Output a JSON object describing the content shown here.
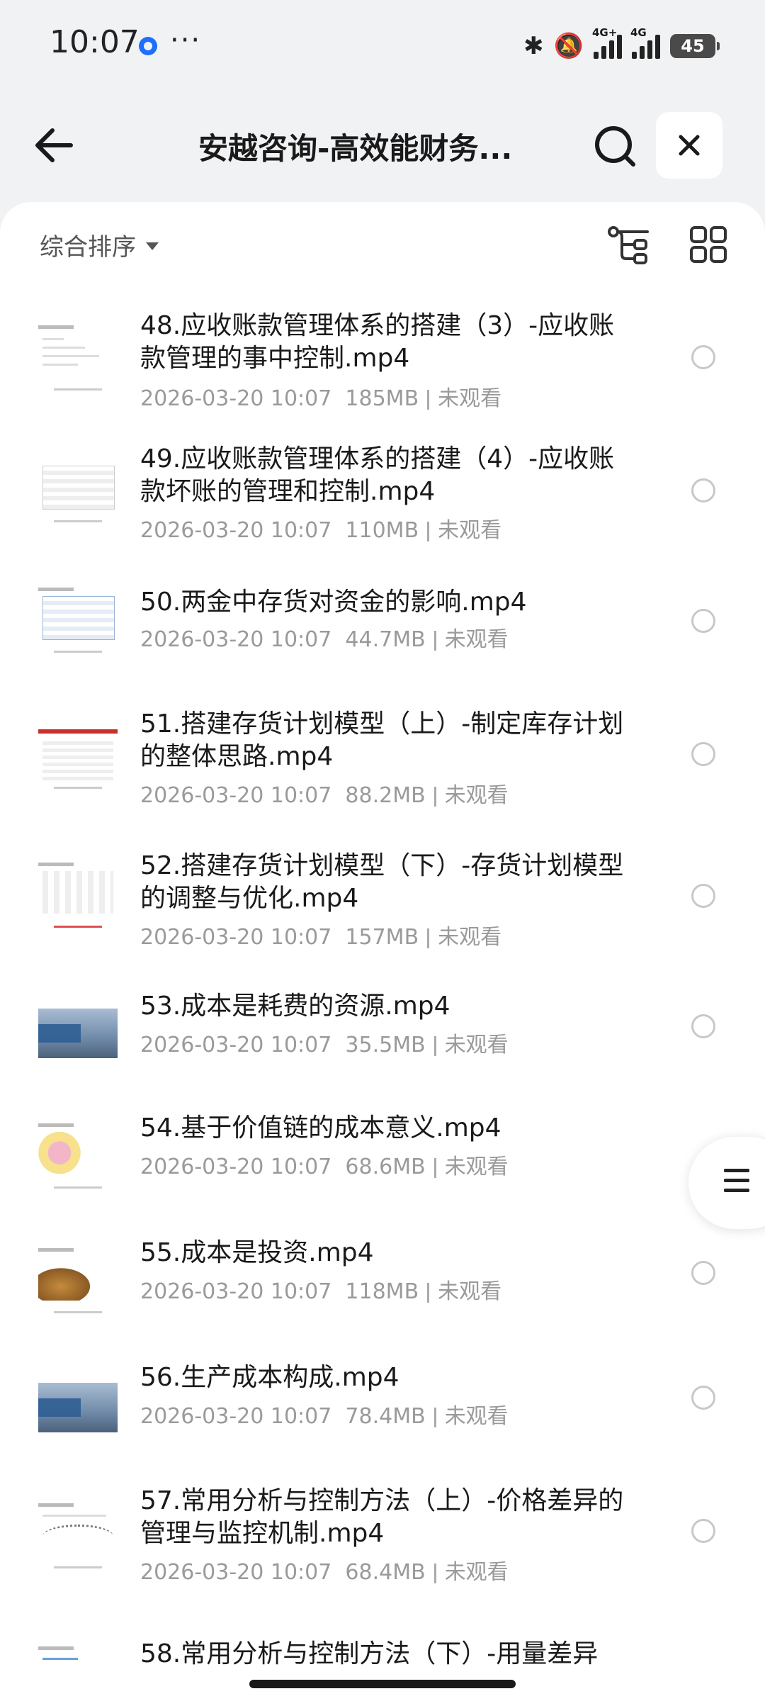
{
  "status": {
    "time": "10:07",
    "more": "···",
    "net1": "4G+",
    "net2": "4G",
    "battery": "45"
  },
  "header": {
    "title": "安越咨询-高效能财务..."
  },
  "toolbar": {
    "sort_label": "综合排序"
  },
  "items": [
    {
      "name": "48.应收账款管理体系的搭建（3）-应收账款管理的事中控制.mp4",
      "date": "2026-03-20 10:07",
      "size": "185MB",
      "status": "未观看"
    },
    {
      "name": "49.应收账款管理体系的搭建（4）-应收账款坏账的管理和控制.mp4",
      "date": "2026-03-20 10:07",
      "size": "110MB",
      "status": "未观看"
    },
    {
      "name": "50.两金中存货对资金的影响.mp4",
      "date": "2026-03-20 10:07",
      "size": "44.7MB",
      "status": "未观看"
    },
    {
      "name": "51.搭建存货计划模型（上）-制定库存计划的整体思路.mp4",
      "date": "2026-03-20 10:07",
      "size": "88.2MB",
      "status": "未观看"
    },
    {
      "name": "52.搭建存货计划模型（下）-存货计划模型的调整与优化.mp4",
      "date": "2026-03-20 10:07",
      "size": "157MB",
      "status": "未观看"
    },
    {
      "name": "53.成本是耗费的资源.mp4",
      "date": "2026-03-20 10:07",
      "size": "35.5MB",
      "status": "未观看"
    },
    {
      "name": "54.基于价值链的成本意义.mp4",
      "date": "2026-03-20 10:07",
      "size": "68.6MB",
      "status": "未观看"
    },
    {
      "name": "55.成本是投资.mp4",
      "date": "2026-03-20 10:07",
      "size": "118MB",
      "status": "未观看"
    },
    {
      "name": "56.生产成本构成.mp4",
      "date": "2026-03-20 10:07",
      "size": "78.4MB",
      "status": "未观看"
    },
    {
      "name": "57.常用分析与控制方法（上）-价格差异的管理与监控机制.mp4",
      "date": "2026-03-20 10:07",
      "size": "68.4MB",
      "status": "未观看"
    },
    {
      "name": "58.常用分析与控制方法（下）-用量差异",
      "date": "",
      "size": "",
      "status": ""
    }
  ]
}
